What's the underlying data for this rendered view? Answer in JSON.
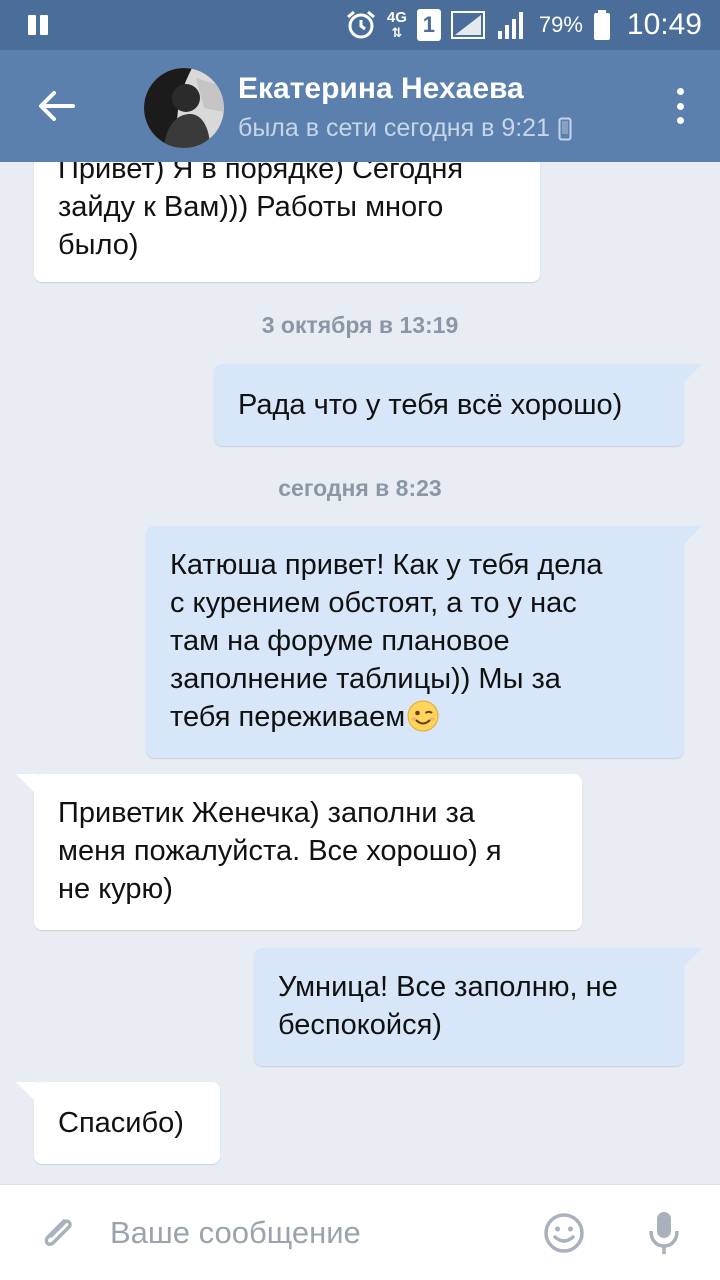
{
  "status_bar": {
    "network": "4G",
    "sim": "1",
    "battery": "79%",
    "time": "10:49",
    "icons": [
      "pause-icon",
      "alarm-icon",
      "signal-icon",
      "battery-icon"
    ]
  },
  "header": {
    "contact_name": "Екатерина Нехаева",
    "contact_status": "была в сети сегодня в 9:21",
    "icons": [
      "back-arrow-icon",
      "avatar",
      "phone-icon",
      "more-vertical-icon"
    ]
  },
  "chat": {
    "messages": [
      {
        "direction": "in",
        "text": "Привет) Я в порядке) Сегодня\nзайду к Вам))) Работы много\nбыло)"
      },
      {
        "type": "date",
        "text": "3 октября в 13:19"
      },
      {
        "direction": "out",
        "text": "Рада что у тебя всё хорошо)"
      },
      {
        "type": "date",
        "text": "сегодня в 8:23"
      },
      {
        "direction": "out",
        "text": "Катюша привет! Как у тебя дела\nс курением обстоят, а то у нас\nтам на форуме плановое\nзаполнение таблицы)) Мы за\nтебя переживаем",
        "emoji": "wink-emoji-icon"
      },
      {
        "direction": "in",
        "text": "Приветик Женечка) заполни за\nменя пожалуйста. Все хорошо) я\nне курю)"
      },
      {
        "direction": "out",
        "text": "Умница! Все заполню, не\nбеспокойся)"
      },
      {
        "direction": "in",
        "text": "Спасибо)"
      }
    ]
  },
  "input_bar": {
    "placeholder": "Ваше сообщение",
    "icons": [
      "paperclip-icon",
      "smiley-icon",
      "microphone-icon"
    ]
  },
  "colors": {
    "status_bar": "#4a6e99",
    "header": "#5b80ad",
    "chat_bg": "#e8edf3",
    "incoming_bubble": "#ffffff",
    "outgoing_bubble": "#d7e6f8",
    "date_text": "#8b97a6"
  }
}
